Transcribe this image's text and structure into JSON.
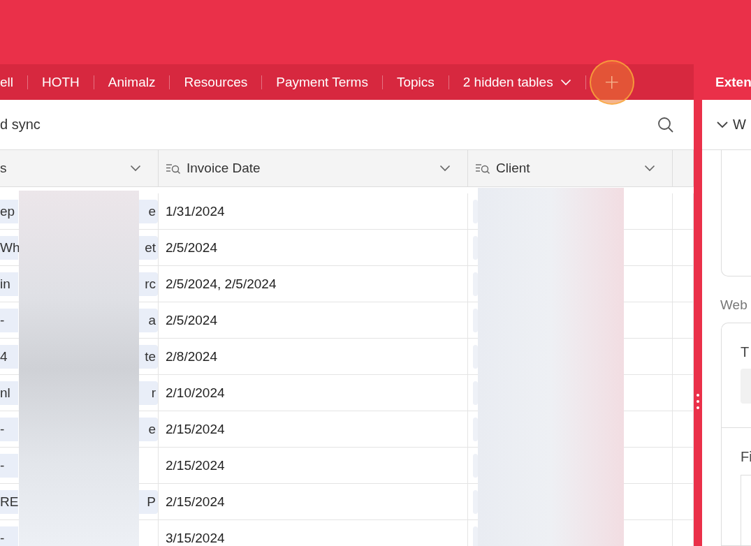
{
  "table_tabs": [
    {
      "label": "ell"
    },
    {
      "label": "HOTH"
    },
    {
      "label": "Animalz"
    },
    {
      "label": "Resources"
    },
    {
      "label": "Payment Terms"
    },
    {
      "label": "Topics"
    }
  ],
  "hidden_tables": {
    "label": "2 hidden tables"
  },
  "add_button": {
    "label": "+"
  },
  "search": {
    "value": "d sync"
  },
  "table": {
    "columns": [
      {
        "label": "s",
        "kind": "text"
      },
      {
        "label": "Invoice Date",
        "kind": "lookup"
      },
      {
        "label": "Client",
        "kind": "lookup"
      }
    ],
    "rows": [
      {
        "name_start": "ep",
        "name_end": "e",
        "invoice_date": "1/31/2024"
      },
      {
        "name_start": "Wh",
        "name_end": "et",
        "invoice_date": "2/5/2024"
      },
      {
        "name_start": "in",
        "name_end": "rc",
        "invoice_date": "2/5/2024, 2/5/2024"
      },
      {
        "name_start": "-",
        "name_end": "a",
        "invoice_date": "2/5/2024"
      },
      {
        "name_start": "4",
        "name_end": "te",
        "invoice_date": "2/8/2024"
      },
      {
        "name_start": "nl",
        "name_end": "r",
        "invoice_date": "2/10/2024"
      },
      {
        "name_start": "-",
        "name_end": "e",
        "invoice_date": "2/15/2024"
      },
      {
        "name_start": "-",
        "invoice_date": "2/15/2024"
      },
      {
        "name_start": "RE",
        "name_end": "P",
        "invoice_date": "2/15/2024"
      },
      {
        "name_start": "-",
        "invoice_date": "3/15/2024"
      }
    ]
  },
  "extensions_panel": {
    "title": "Exten",
    "section": "W",
    "label": "Web",
    "field_label": "T",
    "field_label_2": "Fi"
  }
}
